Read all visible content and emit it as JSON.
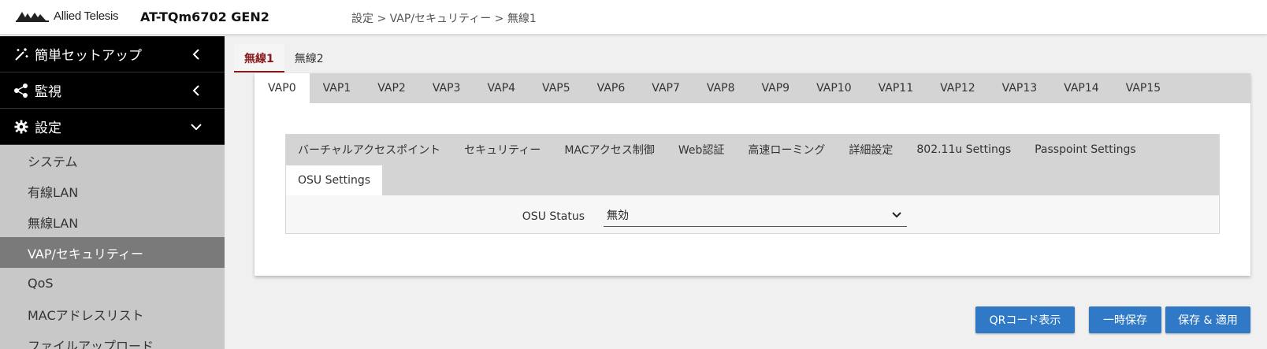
{
  "header": {
    "brand": "Allied Telesis",
    "model": "AT-TQm6702 GEN2",
    "breadcrumb": "設定 > VAP/セキュリティー > 無線1"
  },
  "sidebar": {
    "sections": [
      {
        "label": "簡単セットアップ",
        "icon": "wand-icon",
        "state": "collapsed"
      },
      {
        "label": "監視",
        "icon": "share-icon",
        "state": "collapsed"
      },
      {
        "label": "設定",
        "icon": "gear-icon",
        "state": "expanded"
      }
    ],
    "items": [
      {
        "label": "システム"
      },
      {
        "label": "有線LAN"
      },
      {
        "label": "無線LAN"
      },
      {
        "label": "VAP/セキュリティー",
        "active": true
      },
      {
        "label": "QoS"
      },
      {
        "label": "MACアドレスリスト"
      },
      {
        "label": "ファイルアップロード"
      }
    ]
  },
  "radio_tabs": [
    {
      "label": "無線1",
      "active": true
    },
    {
      "label": "無線2"
    }
  ],
  "vap_tabs": [
    "VAP0",
    "VAP1",
    "VAP2",
    "VAP3",
    "VAP4",
    "VAP5",
    "VAP6",
    "VAP7",
    "VAP8",
    "VAP9",
    "VAP10",
    "VAP11",
    "VAP12",
    "VAP13",
    "VAP14",
    "VAP15"
  ],
  "vap_active": "VAP0",
  "section_tabs": [
    {
      "label": "バーチャルアクセスポイント"
    },
    {
      "label": "セキュリティー"
    },
    {
      "label": "MACアクセス制御"
    },
    {
      "label": "Web認証"
    },
    {
      "label": "高速ローミング"
    },
    {
      "label": "詳細設定"
    },
    {
      "label": "802.11u Settings"
    },
    {
      "label": "Passpoint Settings"
    },
    {
      "label": "OSU Settings",
      "active": true
    }
  ],
  "osu": {
    "label": "OSU Status",
    "value": "無効"
  },
  "buttons": {
    "qr": "QRコード表示",
    "temp_save": "一時保存",
    "save_apply": "保存 & 適用"
  },
  "colors": {
    "primary_button": "#2f79c7",
    "active_radio_tab": "#8a1a1a",
    "sidebar_header": "#000000",
    "sidebar_active": "#7a7a7a"
  }
}
